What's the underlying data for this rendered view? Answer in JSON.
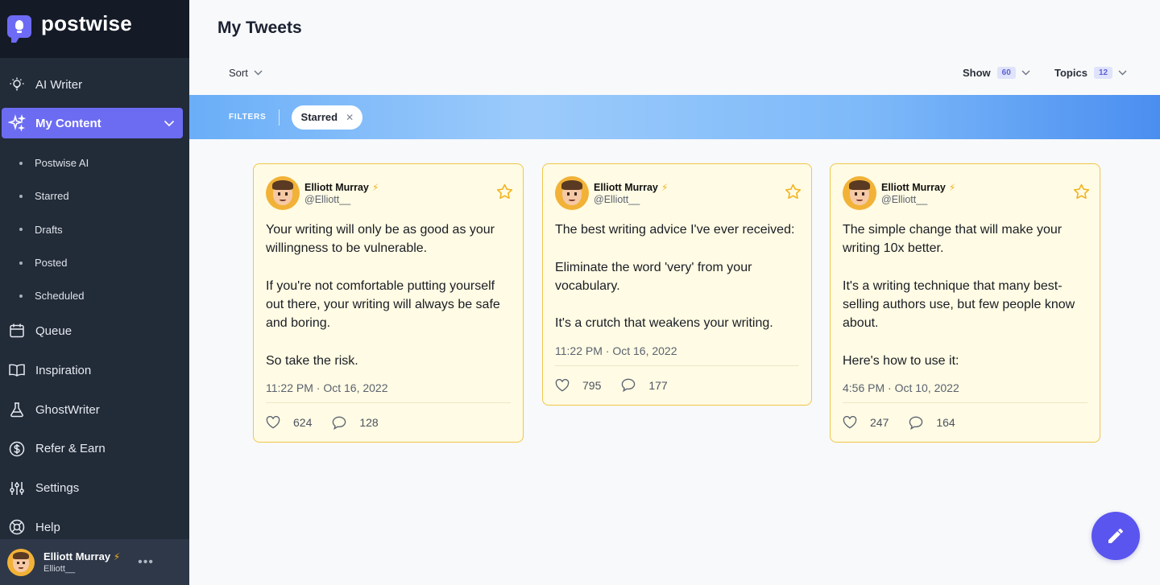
{
  "brand": {
    "name": "postwise"
  },
  "sidebar": {
    "items": [
      {
        "label": "AI Writer",
        "icon": "bulb-icon"
      },
      {
        "label": "My Content",
        "icon": "sparkle-icon",
        "active": true
      },
      {
        "label": "Queue",
        "icon": "calendar-icon"
      },
      {
        "label": "Inspiration",
        "icon": "book-icon"
      },
      {
        "label": "GhostWriter",
        "icon": "flask-icon"
      },
      {
        "label": "Refer & Earn",
        "icon": "dollar-icon"
      },
      {
        "label": "Settings",
        "icon": "sliders-icon"
      },
      {
        "label": "Help",
        "icon": "lifebuoy-icon"
      }
    ],
    "sub_items": [
      {
        "label": "Postwise AI"
      },
      {
        "label": "Starred"
      },
      {
        "label": "Drafts"
      },
      {
        "label": "Posted"
      },
      {
        "label": "Scheduled"
      }
    ]
  },
  "user": {
    "name": "Elliott Murray",
    "handle": "Elliott__"
  },
  "main": {
    "title": "My Tweets",
    "sort_label": "Sort",
    "show_label": "Show",
    "show_count": "60",
    "topics_label": "Topics",
    "topics_count": "12",
    "filters_label": "FILTERS",
    "active_filter": "Starred"
  },
  "tweets": [
    {
      "author": "Elliott Murray",
      "handle": "@Elliott__",
      "paragraphs": [
        "Your writing will only be as good as your willingness to be vulnerable.",
        "If you're not comfortable putting yourself out there, your writing will always be safe and boring.",
        "So take the risk."
      ],
      "time": "11:22 PM · Oct 16, 2022",
      "likes": "624",
      "replies": "128"
    },
    {
      "author": "Elliott Murray",
      "handle": "@Elliott__",
      "paragraphs": [
        "The best writing advice I've ever received:",
        "Eliminate the word 'very' from your vocabulary.",
        "It's a crutch that weakens your writing."
      ],
      "time": "11:22 PM · Oct 16, 2022",
      "likes": "795",
      "replies": "177"
    },
    {
      "author": "Elliott Murray",
      "handle": "@Elliott__",
      "paragraphs": [
        "The simple change that will make your writing 10x better.",
        "It's a writing technique that many best-selling authors use, but few people know about.",
        "Here's how to use it:"
      ],
      "time": "4:56 PM · Oct 10, 2022",
      "likes": "247",
      "replies": "164"
    }
  ],
  "colors": {
    "sidebar_bg": "#222b38",
    "accent": "#6c6cf2",
    "card_bg": "#fffbe4",
    "card_border": "#f0c64b",
    "fab": "#5a55ef"
  }
}
